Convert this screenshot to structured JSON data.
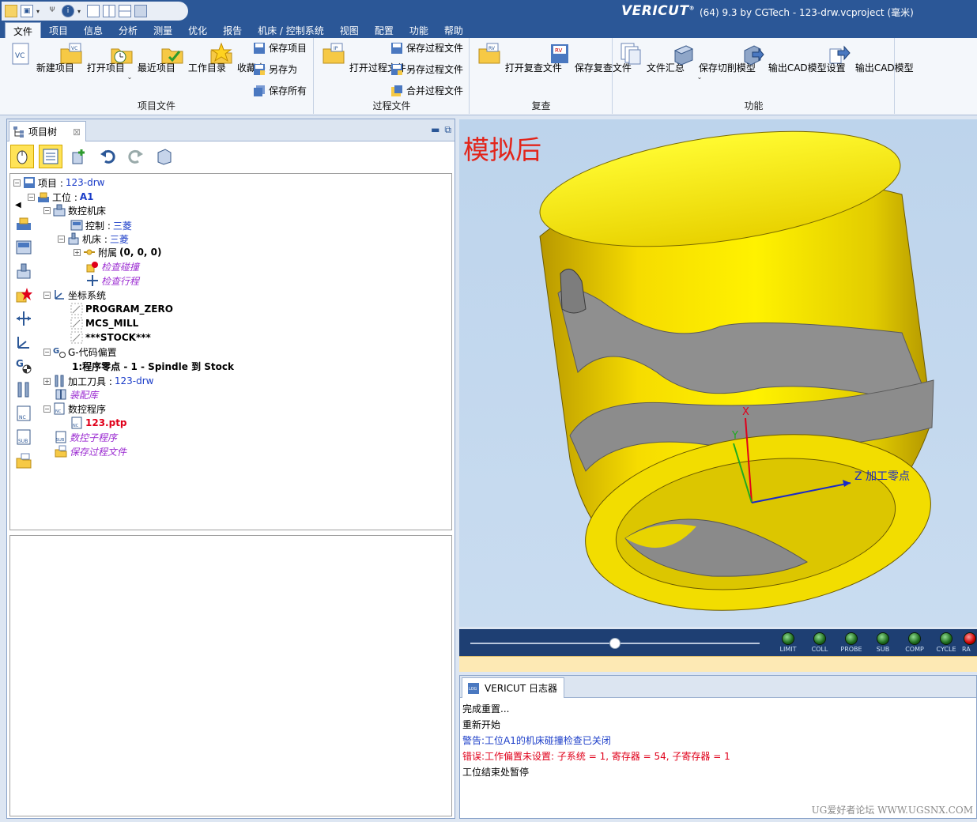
{
  "window": {
    "brand": "VERICUT",
    "title": "(64)  9.3 by CGTech - 123-drw.vcproject (毫米)"
  },
  "menu": [
    "文件",
    "项目",
    "信息",
    "分析",
    "测量",
    "优化",
    "报告",
    "机床 / 控制系统",
    "视图",
    "配置",
    "功能",
    "帮助"
  ],
  "ribbon": {
    "project_file": {
      "title": "项目文件",
      "new_project": "新建项目",
      "open_project": "打开项目",
      "recent_project": "最近项目",
      "work_dir": "工作目录",
      "favorites": "收藏夹",
      "save_project": "保存项目",
      "save_as": "另存为",
      "save_all": "保存所有"
    },
    "process_file": {
      "title": "过程文件",
      "open_process": "打开过程文件",
      "save_process": "保存过程文件",
      "save_process_as": "另存过程文件",
      "merge_process": "合并过程文件"
    },
    "review": {
      "title": "复查",
      "open_review": "打开复查文件",
      "save_review": "保存复查文件"
    },
    "function": {
      "title": "功能",
      "file_summary": "文件汇总",
      "save_cut_model": "保存切削模型",
      "export_cad_settings": "输出CAD模型设置",
      "export_cad": "输出CAD模型"
    }
  },
  "project_tree": {
    "tab_label": "项目树",
    "root_label": "项目 : ",
    "root_value": "123-drw",
    "setup_label": "工位 : ",
    "setup_value": "A1",
    "cnc_machine": "数控机床",
    "control_label": "控制 : ",
    "control_value": "三菱",
    "machine_label": "机床 : ",
    "machine_value": "三菱",
    "attach_label": "附属 ",
    "attach_value": "(0, 0, 0)",
    "collision_check": "检查碰撞",
    "travel_check": "检查行程",
    "coord_system": "坐标系统",
    "cs1": "PROGRAM_ZERO",
    "cs2": "MCS_MILL",
    "cs3": "***STOCK***",
    "gcode_offset": "G-代码偏置",
    "offset_item": "1:程序零点 - 1 - Spindle 到 Stock",
    "tools_label": "加工刀具 : ",
    "tools_value": "123-drw",
    "fixtures": "装配库",
    "nc_programs": "数控程序",
    "nc_file": "123.ptp",
    "nc_subroutines": "数控子程序",
    "save_process_file": "保存过程文件"
  },
  "viewport": {
    "label": "模拟后",
    "axis_x": "X",
    "axis_y": "Y",
    "axis_z": "Z 加工零点"
  },
  "sim_status": [
    "LIMIT",
    "COLL",
    "PROBE",
    "SUB",
    "COMP",
    "CYCLE",
    "RA"
  ],
  "logger": {
    "tab_label": "VERICUT 日志器",
    "line1": "完成重置...",
    "line2": "重新开始",
    "line3": "警告:工位A1的机床碰撞检查已关闭",
    "line4": "错误:工作偏置未设置: 子系统 = 1, 寄存器 = 54, 子寄存器 = 1",
    "line5": "工位结束处暂停"
  },
  "watermark": "UG爱好者论坛 WWW.UGSNX.COM"
}
